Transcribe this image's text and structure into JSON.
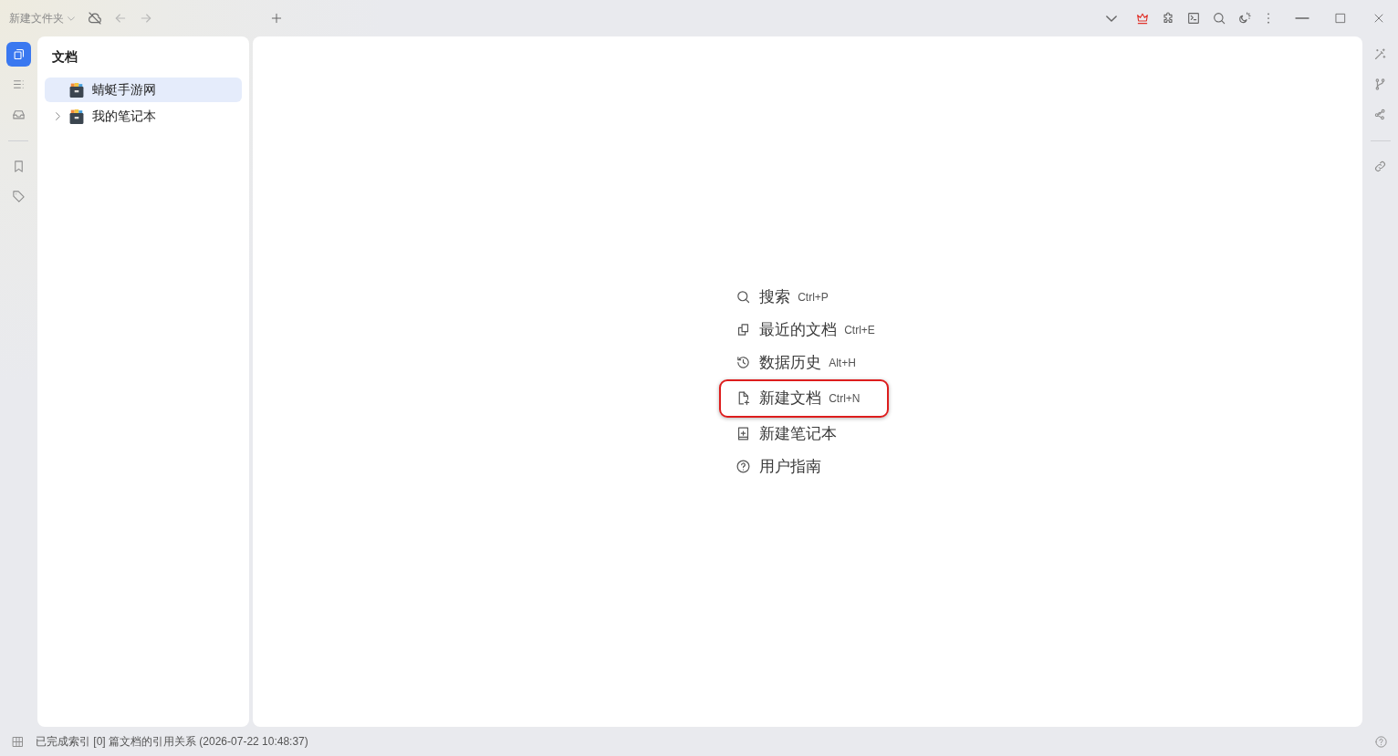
{
  "title_bar": {
    "workspace": "新建文件夹",
    "tools": [
      {
        "kind": "sync_off",
        "disabled": false
      },
      {
        "kind": "back",
        "disabled": true
      },
      {
        "kind": "forward",
        "disabled": true
      },
      {
        "kind": "new_tab",
        "disabled": false
      }
    ],
    "right_tools": [
      {
        "kind": "tab_list"
      },
      {
        "kind": "crown"
      },
      {
        "kind": "plugin"
      },
      {
        "kind": "terminal"
      },
      {
        "kind": "search"
      },
      {
        "kind": "theme"
      },
      {
        "kind": "more"
      }
    ],
    "window_controls": [
      {
        "kind": "minimize"
      },
      {
        "kind": "maximize"
      },
      {
        "kind": "close"
      }
    ]
  },
  "left_dock": {
    "top": [
      {
        "kind": "file_tree",
        "selected": true
      },
      {
        "kind": "outline",
        "selected": false
      },
      {
        "kind": "inbox",
        "selected": false
      }
    ],
    "bottom": [
      {
        "kind": "bookmarks",
        "selected": false
      },
      {
        "kind": "tags",
        "selected": false
      }
    ]
  },
  "file_tree": {
    "title": "文档",
    "notebooks": [
      {
        "name": "蜻蜓手游网",
        "selected": true,
        "expandable": false
      },
      {
        "name": "我的笔记本",
        "selected": false,
        "expandable": true
      }
    ]
  },
  "empty_state_menu": [
    {
      "kind": "search",
      "label": "搜索",
      "shortcut": "Ctrl+P",
      "highlighted": false
    },
    {
      "kind": "recent",
      "label": "最近的文档",
      "shortcut": "Ctrl+E",
      "highlighted": false
    },
    {
      "kind": "history",
      "label": "数据历史",
      "shortcut": "Alt+H",
      "highlighted": false
    },
    {
      "kind": "new_doc",
      "label": "新建文档",
      "shortcut": "Ctrl+N",
      "highlighted": true
    },
    {
      "kind": "new_notebook",
      "label": "新建笔记本",
      "highlighted": false
    },
    {
      "kind": "help",
      "label": "用户指南",
      "highlighted": false
    }
  ],
  "right_dock": {
    "top": [
      {
        "kind": "wand",
        "selected": false
      },
      {
        "kind": "branch",
        "selected": false
      },
      {
        "kind": "graph",
        "selected": false
      }
    ],
    "bottom": [
      {
        "kind": "link",
        "selected": false
      }
    ]
  },
  "status_bar": {
    "left_tools": [
      {
        "kind": "layout"
      }
    ],
    "message": "已完成索引 [0] 篇文档的引用关系 (2026-07-22 10:48:37)",
    "right_tools": [
      {
        "kind": "help"
      }
    ]
  }
}
